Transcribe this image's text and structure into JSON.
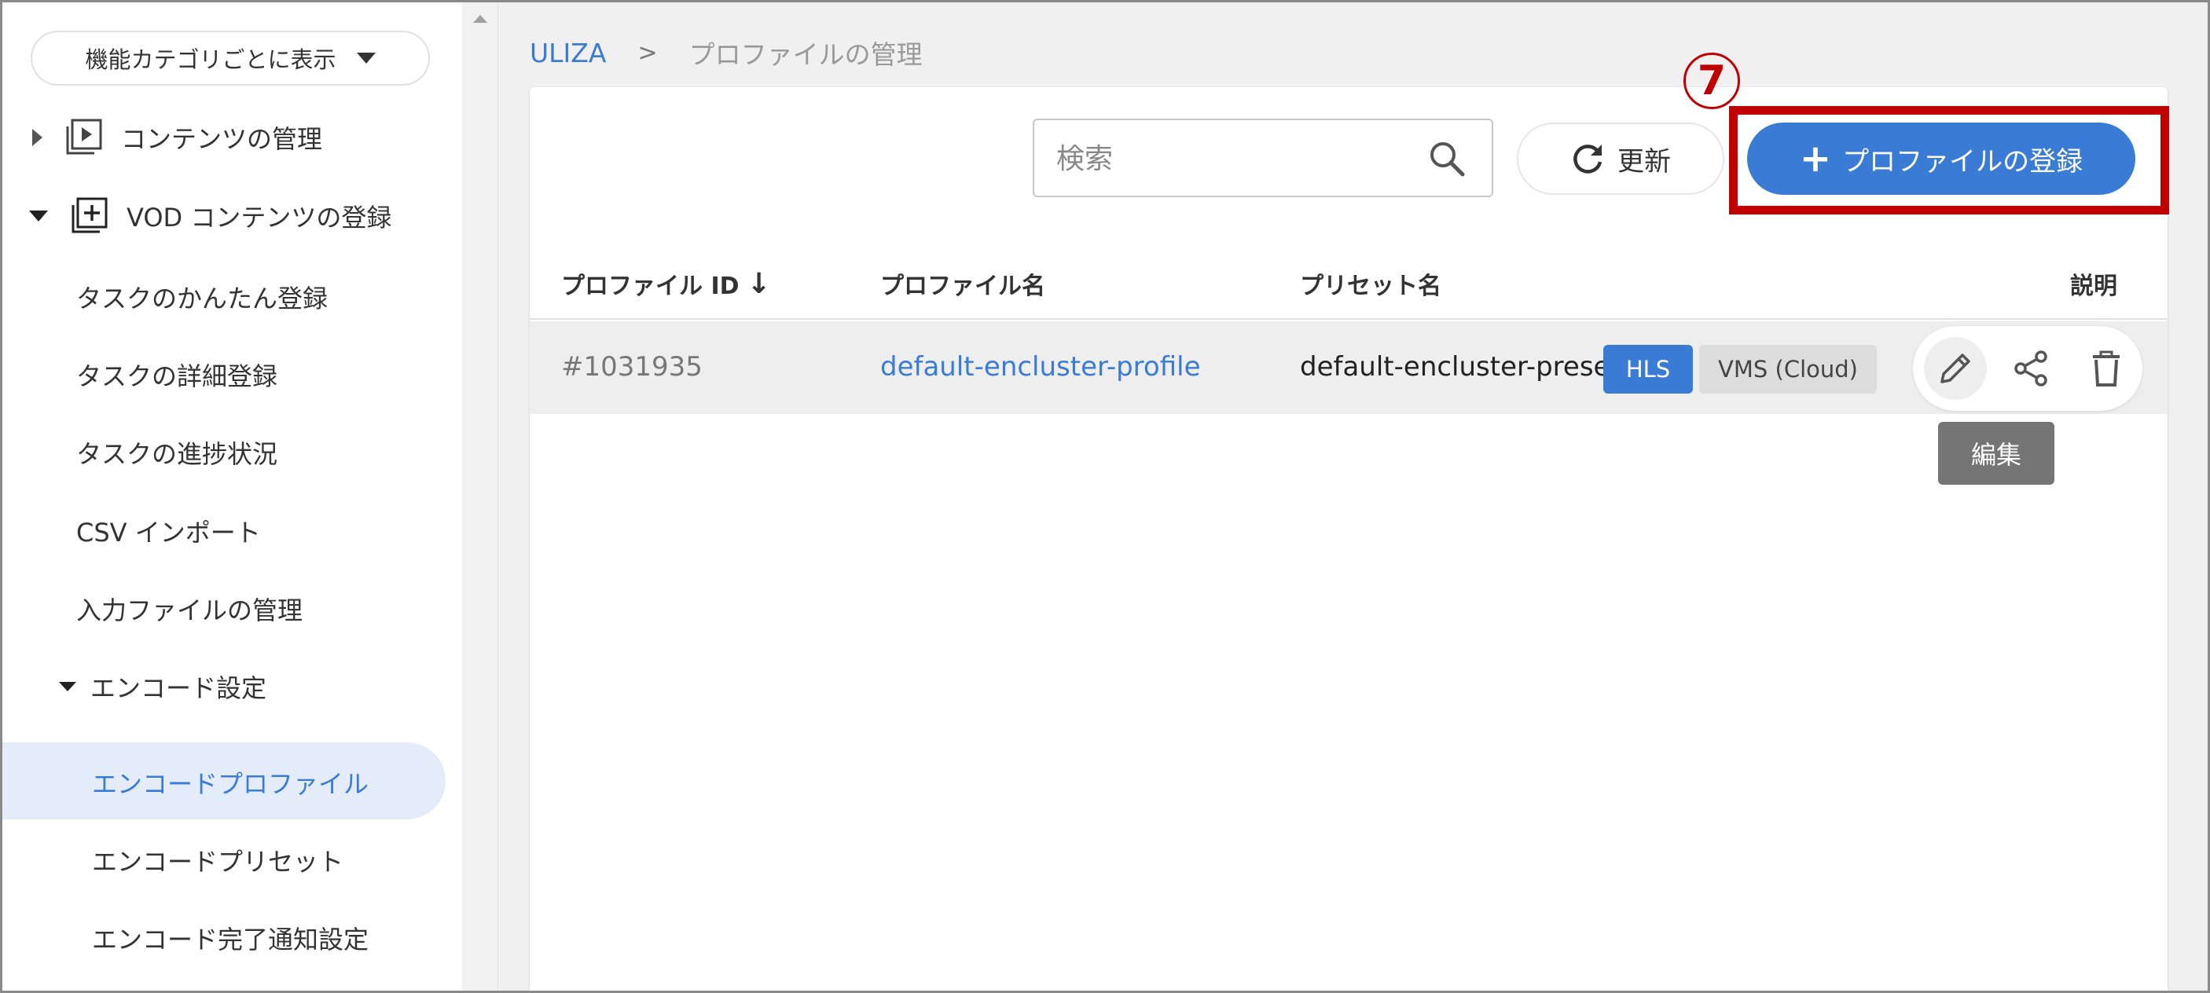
{
  "sidebar": {
    "category_select": "機能カテゴリごとに表示",
    "sections": [
      {
        "label": "コンテンツの管理",
        "icon": "play-library-icon",
        "expanded": false
      },
      {
        "label": "VOD コンテンツの登録",
        "icon": "add-library-icon",
        "expanded": true
      }
    ],
    "items": [
      "タスクのかんたん登録",
      "タスクの詳細登録",
      "タスクの進捗状況",
      "CSV インポート",
      "入力ファイルの管理"
    ],
    "encode_group": {
      "label": "エンコード設定",
      "items": [
        "エンコードプロファイル",
        "エンコードプリセット",
        "エンコード完了通知設定"
      ],
      "active_item": "エンコードプロファイル"
    }
  },
  "breadcrumb": {
    "root": "ULIZA",
    "separator": ">",
    "current": "プロファイルの管理"
  },
  "toolbar": {
    "search_placeholder": "検索",
    "refresh_label": "更新",
    "add_label": "プロファイルの登録",
    "step_marker": "7"
  },
  "table": {
    "headers": {
      "id": "プロファイル ID",
      "name": "プロファイル名",
      "preset": "プリセット名",
      "description": "説明"
    },
    "sort_arrow": "↓",
    "rows": [
      {
        "id": "#1031935",
        "name": "default-encluster-profile",
        "preset": "default-encluster-preset",
        "badges": [
          "HLS",
          "VMS (Cloud)"
        ]
      }
    ]
  },
  "tooltip": "編集",
  "colors": {
    "accent": "#3a7bd5",
    "highlight": "#c00000",
    "active_nav_bg": "#e3ecf8"
  }
}
